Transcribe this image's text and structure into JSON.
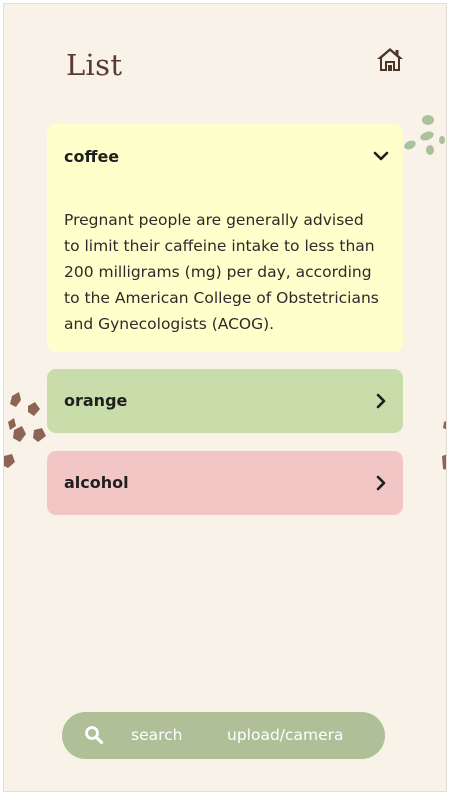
{
  "header": {
    "title": "List",
    "home_icon": "home-icon"
  },
  "items": [
    {
      "label": "coffee",
      "expanded": true,
      "color": "#ffffcc",
      "description": "Pregnant people are generally advised to limit their caffeine intake to less than 200 milligrams (mg) per day, according to the American College of Obstetricians and Gynecologists (ACOG).",
      "icon": "chevron-down-icon"
    },
    {
      "label": "orange",
      "expanded": false,
      "color": "#c9ddaa",
      "icon": "chevron-right-icon"
    },
    {
      "label": "alcohol",
      "expanded": false,
      "color": "#f3c6c6",
      "icon": "chevron-right-icon"
    }
  ],
  "bottom_bar": {
    "search_icon": "search-icon",
    "search_label": "search",
    "upload_label": "upload/camera",
    "color": "#afbf98"
  },
  "colors": {
    "background": "#f8f2e8",
    "title": "#5a3a2c",
    "decor_brown": "#8e6455",
    "decor_green": "#a9c29a"
  }
}
